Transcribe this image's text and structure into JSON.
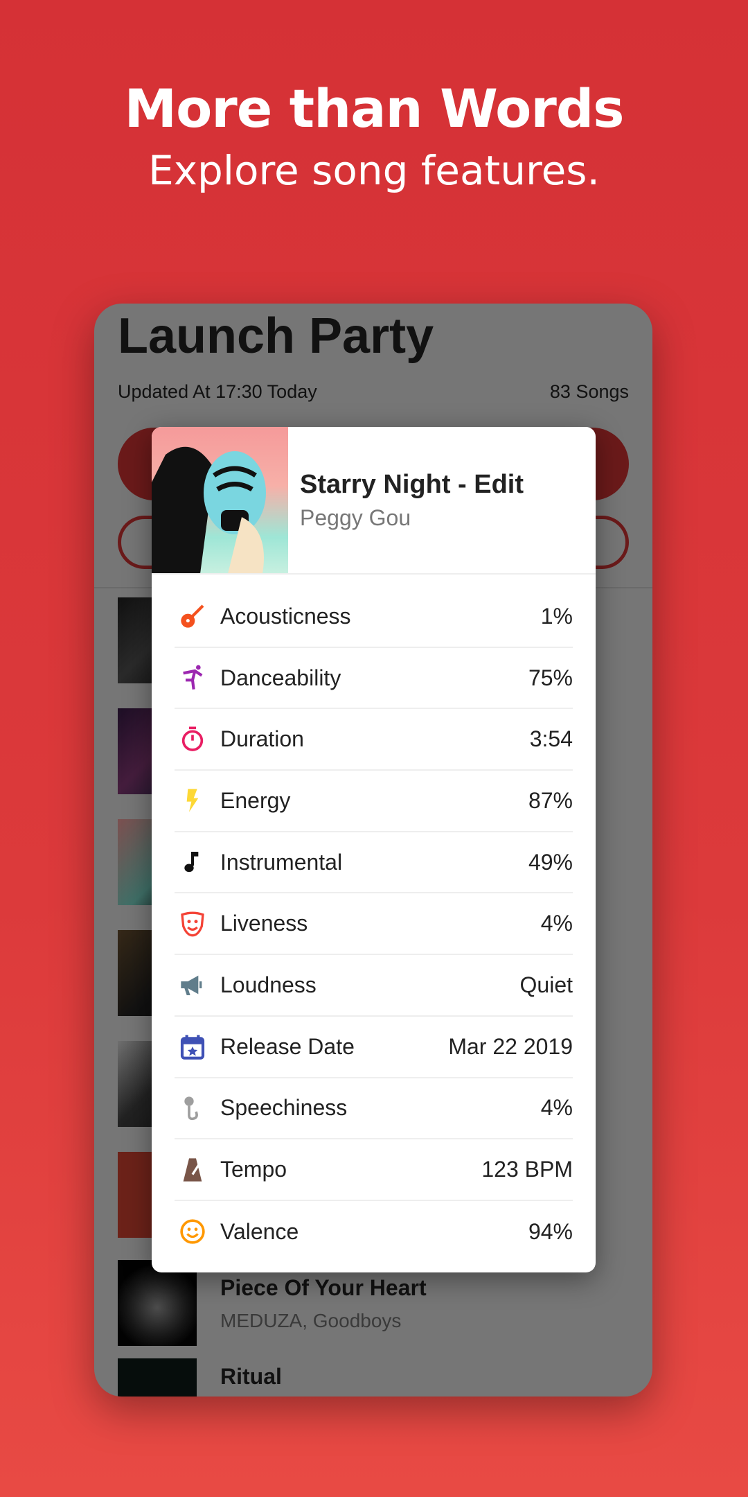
{
  "promo": {
    "headline": "More than Words",
    "subheadline": "Explore song features."
  },
  "playlist": {
    "title": "Launch Party",
    "updated": "Updated At 17:30 Today",
    "song_count": "83 Songs"
  },
  "songs": [
    {
      "title": "Piece Of Your Heart",
      "artist": "MEDUZA, Goodboys"
    },
    {
      "title": "Ritual",
      "artist": ""
    }
  ],
  "popup": {
    "title": "Starry Night - Edit",
    "artist": "Peggy Gou",
    "features": [
      {
        "icon": "guitar-icon",
        "color": "#f4511e",
        "label": "Acousticness",
        "value": "1%"
      },
      {
        "icon": "dancer-icon",
        "color": "#9c27b0",
        "label": "Danceability",
        "value": "75%"
      },
      {
        "icon": "timer-icon",
        "color": "#e91e63",
        "label": "Duration",
        "value": "3:54"
      },
      {
        "icon": "lightning-icon",
        "color": "#fdd835",
        "label": "Energy",
        "value": "87%"
      },
      {
        "icon": "music-note-icon",
        "color": "#111111",
        "label": "Instrumental",
        "value": "49%"
      },
      {
        "icon": "theater-mask-icon",
        "color": "#f44336",
        "label": "Liveness",
        "value": "4%"
      },
      {
        "icon": "megaphone-icon",
        "color": "#607d8b",
        "label": "Loudness",
        "value": "Quiet"
      },
      {
        "icon": "calendar-star-icon",
        "color": "#3f51b5",
        "label": "Release Date",
        "value": "Mar 22 2019"
      },
      {
        "icon": "microphone-icon",
        "color": "#9e9e9e",
        "label": "Speechiness",
        "value": "4%"
      },
      {
        "icon": "metronome-icon",
        "color": "#795548",
        "label": "Tempo",
        "value": "123 BPM"
      },
      {
        "icon": "smiley-icon",
        "color": "#ff9800",
        "label": "Valence",
        "value": "94%"
      }
    ]
  }
}
